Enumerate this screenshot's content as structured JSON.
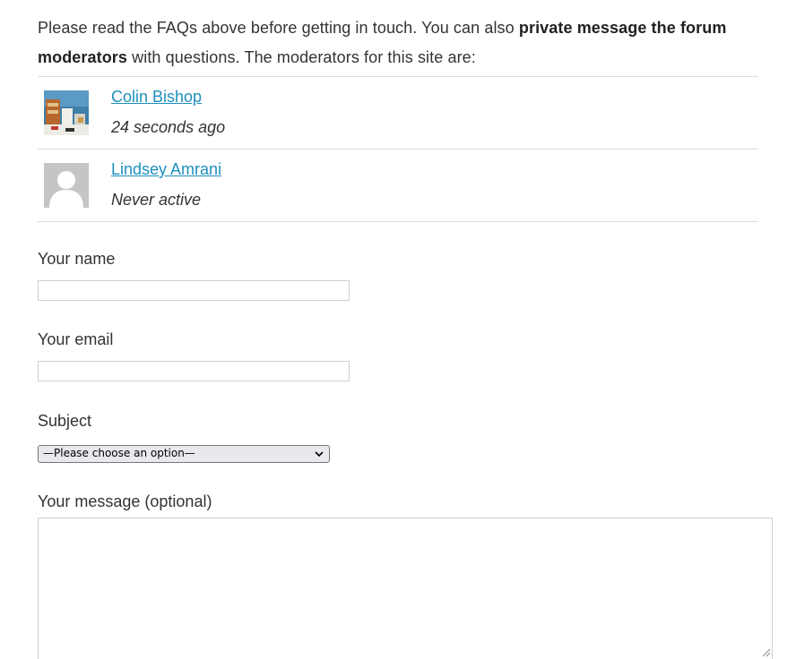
{
  "intro": {
    "text_before": "Please read the FAQs above before getting in touch. You can also ",
    "bold_text": "private message the forum moderators",
    "text_after": " with questions. The moderators for this site are:"
  },
  "moderators": [
    {
      "name": "Colin Bishop",
      "status": "24 seconds ago",
      "avatar": "photo-avatar"
    },
    {
      "name": "Lindsey Amrani",
      "status": "Never active",
      "avatar": "default-person-avatar"
    }
  ],
  "form": {
    "name_label": "Your name",
    "name_value": "",
    "email_label": "Your email",
    "email_value": "",
    "subject_label": "Subject",
    "subject_selected": "—Please choose an option—",
    "message_label": "Your message (optional)",
    "message_value": ""
  },
  "icons": {
    "select_chevron": "chevron-down-icon",
    "textarea_grip": "resize-grip-icon"
  },
  "colors": {
    "link": "#1f8fbd",
    "text": "#333333",
    "divider": "#dddddd"
  }
}
